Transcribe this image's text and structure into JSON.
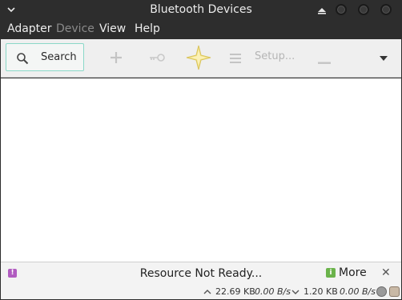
{
  "window": {
    "title": "Bluetooth Devices"
  },
  "menubar": {
    "items": [
      {
        "label": "Adapter",
        "enabled": true
      },
      {
        "label": "Device",
        "enabled": false
      },
      {
        "label": "View",
        "enabled": true
      },
      {
        "label": "Help",
        "enabled": true
      }
    ]
  },
  "toolbar": {
    "search_label": "Search",
    "setup_label": "Setup...",
    "icons": [
      "search-icon",
      "add-icon",
      "key-icon",
      "star-icon",
      "menu-lines-icon",
      "remove-icon",
      "chevron-down-icon"
    ]
  },
  "infobar": {
    "message": "Resource Not Ready...",
    "more_label": "More",
    "close_glyph": "✕",
    "warn_glyph": "!",
    "info_glyph": "i"
  },
  "stats": {
    "upload_total": "22.69 KB",
    "upload_rate": "0.00 B/s",
    "download_total": "1.20 KB",
    "download_rate": "0.00 B/s"
  },
  "colors": {
    "titlebar": "#2d2d2d",
    "search_border": "#8ad8c8",
    "warn": "#b15cc0",
    "info": "#6bb34b",
    "star": "#f3e38a"
  }
}
